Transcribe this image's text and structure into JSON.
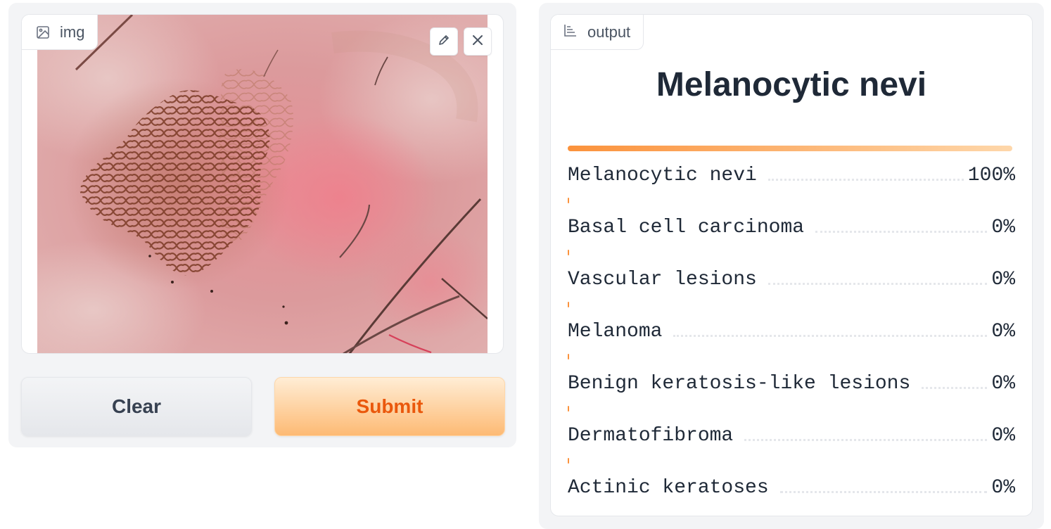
{
  "input": {
    "label": "img"
  },
  "buttons": {
    "clear": "Clear",
    "submit": "Submit"
  },
  "output": {
    "label": "output",
    "title": "Melanocytic nevi",
    "confidences": [
      {
        "label": "Melanocytic nevi",
        "value": "100%",
        "fraction": 1.0
      },
      {
        "label": "Basal cell carcinoma",
        "value": "0%",
        "fraction": 0.0
      },
      {
        "label": "Vascular lesions",
        "value": "0%",
        "fraction": 0.0
      },
      {
        "label": "Melanoma",
        "value": "0%",
        "fraction": 0.0
      },
      {
        "label": "Benign keratosis-like lesions",
        "value": "0%",
        "fraction": 0.0
      },
      {
        "label": "Dermatofibroma",
        "value": "0%",
        "fraction": 0.0
      },
      {
        "label": "Actinic keratoses",
        "value": "0%",
        "fraction": 0.0
      }
    ]
  },
  "colors": {
    "accent": "#f97316",
    "bar_start": "#fb923c",
    "bar_end": "#fed7aa",
    "panel_bg": "#f3f4f6"
  },
  "icons": {
    "input_label": "image-icon",
    "output_label": "bar-chart-icon",
    "edit": "pencil-icon",
    "close": "close-icon"
  }
}
